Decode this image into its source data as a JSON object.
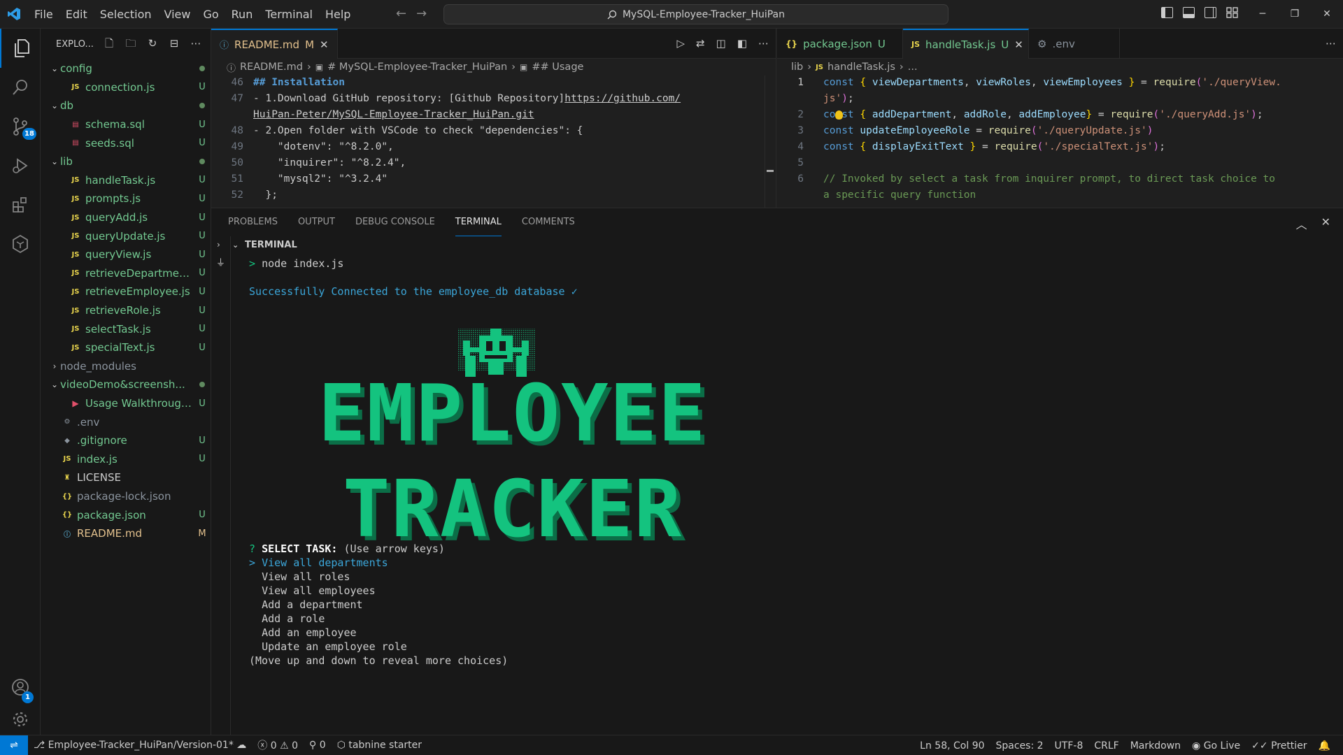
{
  "menu": [
    "File",
    "Edit",
    "Selection",
    "View",
    "Go",
    "Run",
    "Terminal",
    "Help"
  ],
  "title_search": "MySQL-Employee-Tracker_HuiPan",
  "sidebar": {
    "title": "EXPLO...",
    "items": [
      {
        "name": "config",
        "type": "folder-open",
        "status": "dot",
        "color": "green"
      },
      {
        "name": "connection.js",
        "type": "js",
        "status": "U",
        "color": "green"
      },
      {
        "name": "db",
        "type": "folder-open",
        "status": "dot",
        "color": "green"
      },
      {
        "name": "schema.sql",
        "type": "sql",
        "status": "U",
        "color": "green"
      },
      {
        "name": "seeds.sql",
        "type": "sql",
        "status": "U",
        "color": "green"
      },
      {
        "name": "lib",
        "type": "folder-open",
        "status": "dot",
        "color": "green"
      },
      {
        "name": "handleTask.js",
        "type": "js",
        "status": "U",
        "color": "green"
      },
      {
        "name": "prompts.js",
        "type": "js",
        "status": "U",
        "color": "green"
      },
      {
        "name": "queryAdd.js",
        "type": "js",
        "status": "U",
        "color": "green"
      },
      {
        "name": "queryUpdate.js",
        "type": "js",
        "status": "U",
        "color": "green"
      },
      {
        "name": "queryView.js",
        "type": "js",
        "status": "U",
        "color": "green"
      },
      {
        "name": "retrieveDepartments.js",
        "type": "js",
        "status": "U",
        "color": "green"
      },
      {
        "name": "retrieveEmployee.js",
        "type": "js",
        "status": "U",
        "color": "green"
      },
      {
        "name": "retrieveRole.js",
        "type": "js",
        "status": "U",
        "color": "green"
      },
      {
        "name": "selectTask.js",
        "type": "js",
        "status": "U",
        "color": "green"
      },
      {
        "name": "specialText.js",
        "type": "js",
        "status": "U",
        "color": "green"
      },
      {
        "name": "node_modules",
        "type": "folder-closed",
        "status": "",
        "color": "gray"
      },
      {
        "name": "videoDemo&screensh...",
        "type": "folder-open",
        "status": "dot",
        "color": "green"
      },
      {
        "name": "Usage Walkthrough ...",
        "type": "video",
        "status": "U",
        "color": "green"
      },
      {
        "name": ".env",
        "type": "gear",
        "status": "",
        "color": "gray"
      },
      {
        "name": ".gitignore",
        "type": "git",
        "status": "U",
        "color": "green"
      },
      {
        "name": "index.js",
        "type": "js",
        "status": "U",
        "color": "green"
      },
      {
        "name": "LICENSE",
        "type": "license",
        "status": "",
        "color": "plain"
      },
      {
        "name": "package-lock.json",
        "type": "json",
        "status": "",
        "color": "gray"
      },
      {
        "name": "package.json",
        "type": "json",
        "status": "U",
        "color": "green"
      },
      {
        "name": "README.md",
        "type": "info",
        "status": "M",
        "color": "orange"
      }
    ]
  },
  "editor_left": {
    "tab": {
      "label": "README.md",
      "status": "M"
    },
    "breadcrumb": [
      "README.md",
      "# MySQL-Employee-Tracker_HuiPan",
      "## Usage"
    ],
    "lines": [
      {
        "n": "46",
        "text": "## Installation"
      },
      {
        "n": "47",
        "text": "- 1.Download GitHub repository: [Github Repository]",
        "link": "https://github.com/",
        "cont": "HuiPan-Peter/MySQL-Employee-Tracker_HuiPan.git"
      },
      {
        "n": "48",
        "text": "- 2.Open folder with VSCode to check \"dependencies\": {"
      },
      {
        "n": "49",
        "text": "    \"dotenv\": \"^8.2.0\","
      },
      {
        "n": "50",
        "text": "    \"inquirer\": \"^8.2.4\","
      },
      {
        "n": "51",
        "text": "    \"mysql2\": \"^3.2.4\""
      },
      {
        "n": "52",
        "text": "  };"
      }
    ]
  },
  "editor_right": {
    "tabs": [
      {
        "label": "package.json",
        "status": "U",
        "icon": "{}"
      },
      {
        "label": "handleTask.js",
        "status": "U",
        "icon": "JS"
      },
      {
        "label": ".env",
        "status": "",
        "icon": "gear"
      }
    ],
    "breadcrumb": [
      "lib",
      "handleTask.js",
      "..."
    ],
    "line_numbers": [
      "1",
      "2",
      "3",
      "4",
      "5",
      "6"
    ]
  },
  "panel": {
    "tabs": [
      "PROBLEMS",
      "OUTPUT",
      "DEBUG CONSOLE",
      "TERMINAL",
      "COMMENTS"
    ],
    "active_tab": "TERMINAL",
    "terminal_title": "TERMINAL",
    "command": "node index.js",
    "connected": "Successfully Connected to the employee_db database ✓",
    "banner_line1": "EMPLOYEE",
    "banner_line2": "TRACKER",
    "prompt_label": "SELECT TASK:",
    "prompt_hint": "(Use arrow keys)",
    "choices": [
      "View all departments",
      "View all roles",
      "View all employees",
      "Add a department",
      "Add a role",
      "Add an employee",
      "Update an employee role"
    ],
    "more_hint": "(Move up and down to reveal more choices)"
  },
  "statusbar": {
    "branch": "Employee-Tracker_HuiPan/Version-01*",
    "errors": "0",
    "warnings": "0",
    "ports": "0",
    "tabnine": "tabnine starter",
    "position": "Ln 58, Col 90",
    "spaces": "Spaces: 2",
    "encoding": "UTF-8",
    "eol": "CRLF",
    "language": "Markdown",
    "golive": "Go Live",
    "prettier": "Prettier"
  },
  "badges": {
    "source_control": "18",
    "accounts": "1"
  },
  "colors": {
    "accent": "#0078d4",
    "untracked": "#73c991",
    "modified": "#e2c08d",
    "terminal_green": "#14c37f",
    "terminal_cyan": "#3ba6d9"
  }
}
